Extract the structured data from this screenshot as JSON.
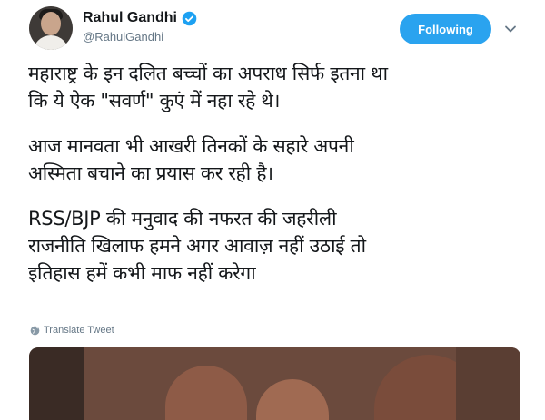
{
  "user": {
    "name": "Rahul Gandhi",
    "handle": "@RahulGandhi",
    "verified_icon": "verified-badge-icon"
  },
  "header": {
    "follow_label": "Following",
    "menu_icon": "chevron-down-icon"
  },
  "tweet": {
    "paragraphs": [
      "महाराष्ट्र के इन दलित बच्चों का अपराध सिर्फ इतना था\nकि ये ऐक \"सवर्ण\" कुएं में नहा रहे थे।",
      "आज मानवता भी आखरी तिनकों के सहारे अपनी\nअस्मिता बचाने का प्रयास कर रही है।",
      "RSS/BJP की मनुवाद की नफरत की जहरीली\nराजनीति खिलाफ हमने अगर आवाज़ नहीं उठाई तो\nइतिहास हमें कभी माफ नहीं करेगा"
    ]
  },
  "translate": {
    "label": "Translate Tweet",
    "icon": "globe-icon"
  },
  "colors": {
    "accent": "#2aa3ef",
    "text": "#14171a",
    "muted": "#657786"
  }
}
